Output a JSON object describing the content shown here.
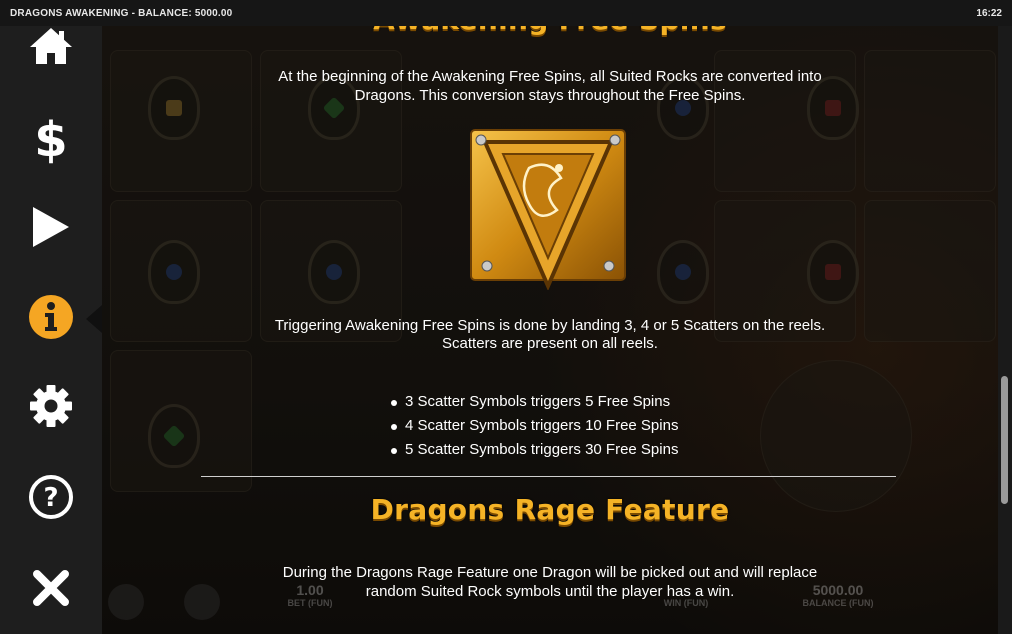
{
  "titlebar": {
    "game_title": "DRAGONS AWAKENING - BALANCE: 5000.00",
    "clock": "16:22"
  },
  "sidebar": {
    "items": [
      {
        "name": "home",
        "icon": "home-icon"
      },
      {
        "name": "bet",
        "icon": "dollar-icon"
      },
      {
        "name": "autoplay",
        "icon": "play-icon"
      },
      {
        "name": "info",
        "icon": "info-icon",
        "active": true
      },
      {
        "name": "settings",
        "icon": "gear-icon"
      },
      {
        "name": "help",
        "icon": "question-icon"
      },
      {
        "name": "close",
        "icon": "close-icon"
      }
    ]
  },
  "sections": {
    "free_spins": {
      "title": "Awakening Free Spins",
      "intro_line1": "At the beginning of the Awakening Free Spins, all Suited Rocks are converted into",
      "intro_line2": "Dragons. This conversion stays throughout the Free Spins.",
      "symbol_name": "scatter-symbol",
      "trigger_line1": "Triggering Awakening Free Spins is done by landing 3, 4 or 5 Scatters on the reels.",
      "trigger_line2": "Scatters are present on all reels.",
      "bullets": [
        "3 Scatter Symbols triggers 5 Free Spins",
        "4 Scatter Symbols triggers 10 Free Spins",
        "5 Scatter Symbols triggers 30 Free Spins"
      ]
    },
    "rage": {
      "title": "Dragons Rage Feature",
      "line1": "During the Dragons Rage Feature one Dragon will be picked out and will replace",
      "line2": "random Suited Rock symbols until the player has a win."
    }
  },
  "hud": {
    "bet_value": "1.00",
    "bet_label": "BET (FUN)",
    "win_label": "WIN (FUN)",
    "balance_value": "5000.00",
    "balance_label": "BALANCE (FUN)"
  },
  "colors": {
    "heading": "#f5b326",
    "info_active": "#f5a623",
    "sidebar_bg": "#1e1e1e"
  }
}
